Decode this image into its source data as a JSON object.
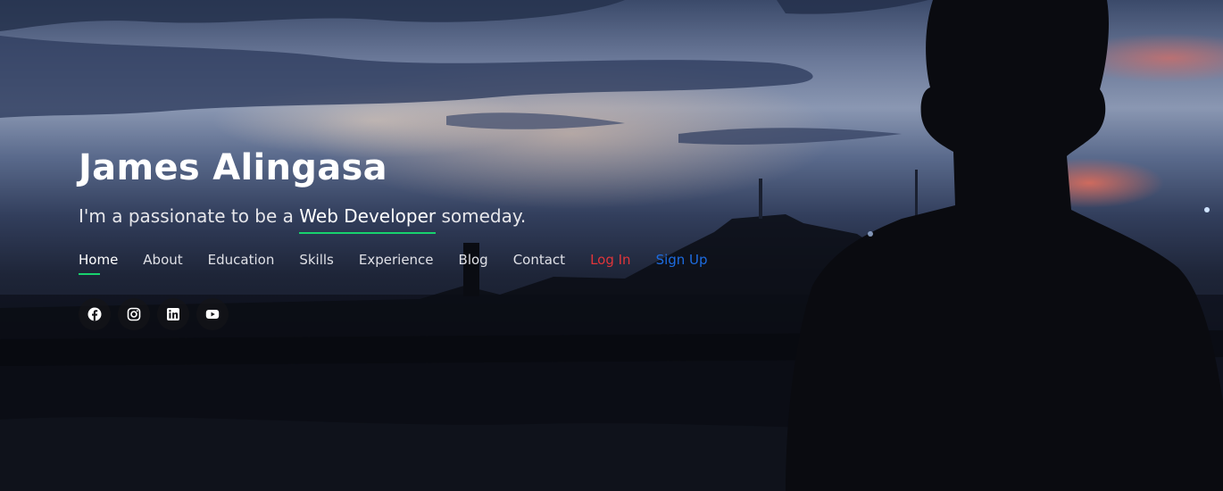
{
  "hero": {
    "name": "James Alingasa",
    "tagline_prefix": "I'm a passionate to be a ",
    "tagline_highlight": "Web Developer",
    "tagline_suffix": " someday.",
    "accent_color": "#18d26e"
  },
  "nav": {
    "items": [
      {
        "label": "Home",
        "active": true
      },
      {
        "label": "About"
      },
      {
        "label": "Education"
      },
      {
        "label": "Skills"
      },
      {
        "label": "Experience"
      },
      {
        "label": "Blog"
      },
      {
        "label": "Contact"
      },
      {
        "label": "Log In",
        "color": "#e0353a"
      },
      {
        "label": "Sign Up",
        "color": "#1d6ce0"
      }
    ]
  },
  "socials": [
    {
      "icon": "facebook-icon"
    },
    {
      "icon": "instagram-icon"
    },
    {
      "icon": "linkedin-icon"
    },
    {
      "icon": "youtube-icon"
    }
  ]
}
